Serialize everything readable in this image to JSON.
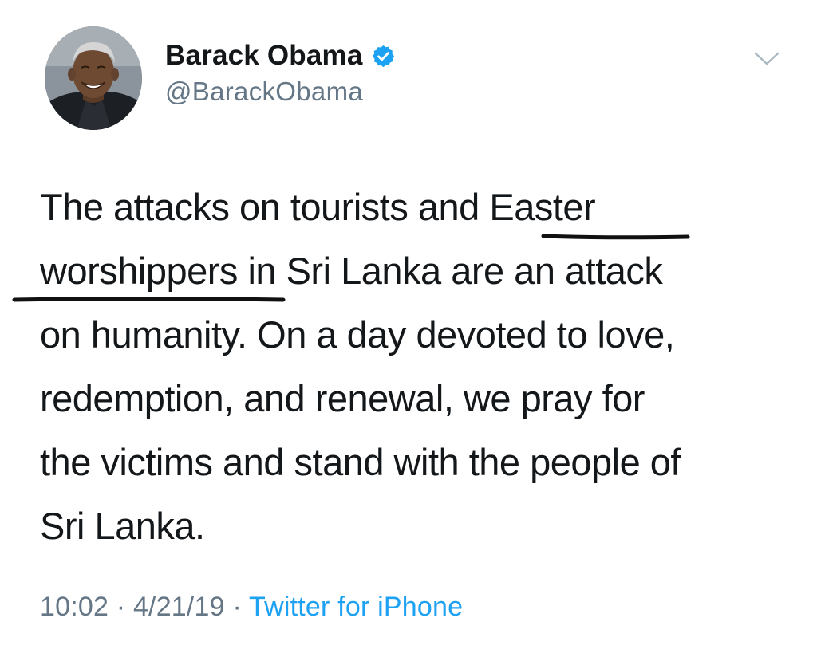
{
  "author": {
    "display_name": "Barack Obama",
    "handle": "@BarackObama",
    "verified": true,
    "avatar_icon": "profile-photo"
  },
  "menu_icon": "chevron-down-icon",
  "tweet": {
    "lines": [
      "The attacks on tourists and Easter",
      "worshippers in Sri Lanka are an attack",
      "on humanity. On a day devoted to love,",
      "redemption, and renewal, we pray for",
      "the victims and stand with the people of",
      "Sri Lanka."
    ],
    "annotation": "hand-drawn underline under \"Easter worshippers\""
  },
  "meta": {
    "time": "10:02",
    "separator": "·",
    "date": "4/21/19",
    "source": "Twitter for iPhone"
  },
  "colors": {
    "text": "#14171a",
    "secondary": "#657786",
    "link": "#1da1f2",
    "verified_badge": "#1da1f2"
  }
}
